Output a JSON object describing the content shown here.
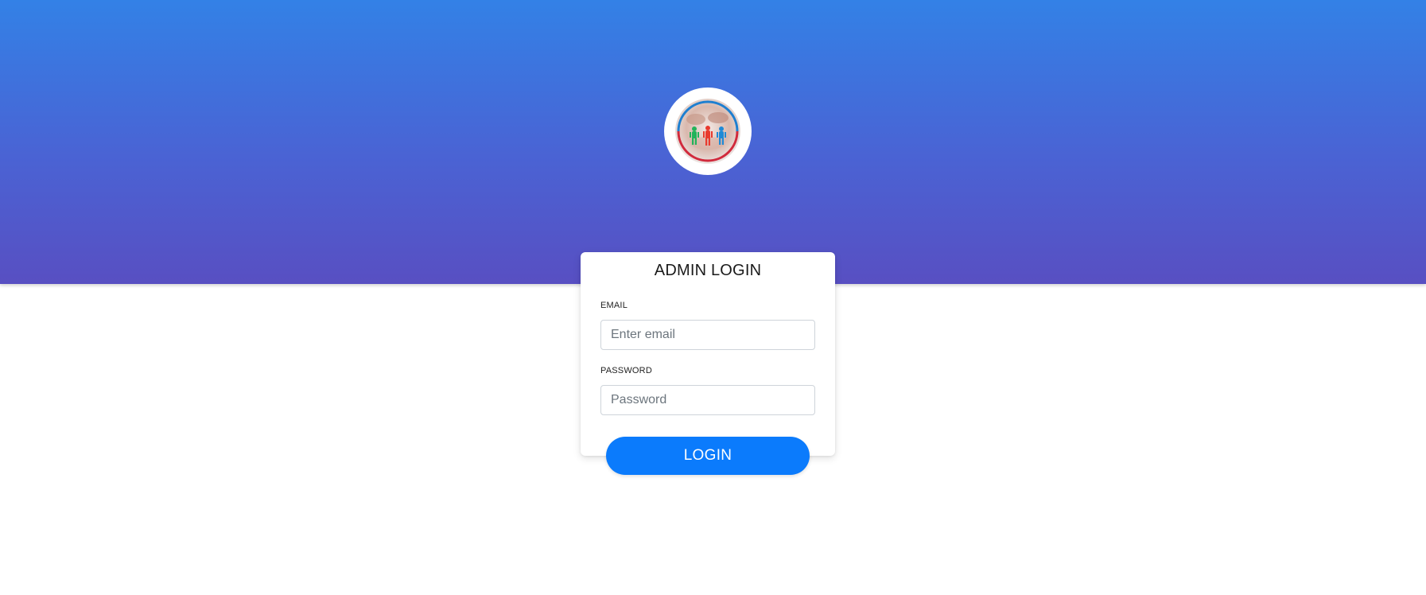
{
  "logo": {
    "icon": "people-circle-logo-icon",
    "colors": {
      "ring_top": "#1e7fd0",
      "ring_bottom": "#d12a3c",
      "figure_left": "#22b35a",
      "figure_middle": "#e83a2e",
      "figure_right": "#1f8ad6"
    }
  },
  "login_card": {
    "title": "ADMIN LOGIN",
    "email": {
      "label": "EMAIL",
      "placeholder": "Enter email",
      "value": ""
    },
    "password": {
      "label": "PASSWORD",
      "placeholder": "Password",
      "value": ""
    },
    "submit_label": "LOGIN"
  },
  "colors": {
    "header_gradient_top": "#3381e6",
    "header_gradient_bottom": "#584fc2",
    "button": "#0b7bfc"
  }
}
